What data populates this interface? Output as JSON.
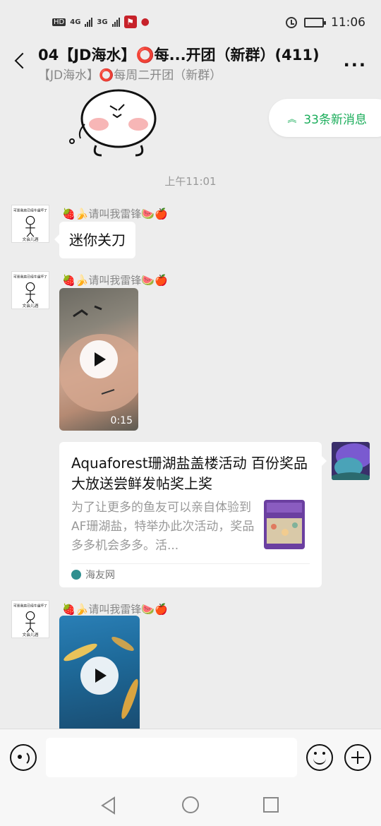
{
  "status_bar": {
    "hd": "HD",
    "sim1": "4G",
    "sim2": "3G",
    "time": "11:06"
  },
  "header": {
    "title": "04【JD海水】⭕每...开团（新群）(411)",
    "subtitle": "【JD海水】⭕每周二开团（新群）",
    "more_label": "..."
  },
  "new_messages": {
    "label": "33条新消息"
  },
  "chat": {
    "timestamp": "上午11:01",
    "messages": [
      {
        "sender": "🍓🍌请叫我雷锋🍉🍎",
        "type": "text",
        "text": "迷你关刀"
      },
      {
        "sender": "🍓🍌请叫我雷锋🍉🍎",
        "type": "video",
        "duration": "0:15"
      },
      {
        "sender": "self",
        "type": "link_card",
        "title": "Aquaforest珊湖盐盖楼活动 百份奖品大放送尝鲜发帖奖上奖",
        "description": "为了让更多的鱼友可以亲自体验到AF珊湖盐，特举办此次活动，奖品多多机会多多。活...",
        "source": "海友网"
      },
      {
        "sender": "🍓🍌请叫我雷锋🍉🍎",
        "type": "video",
        "duration": ""
      }
    ],
    "avatar_caption": "可恶我竟已经牛逼坏了",
    "avatar_footer": "文会儿酒"
  },
  "colors": {
    "accent": "#1aad5a",
    "background": "#ededed"
  },
  "icons": [
    "back-icon",
    "more-icon",
    "voice-icon",
    "emoji-icon",
    "plus-icon",
    "play-icon"
  ]
}
